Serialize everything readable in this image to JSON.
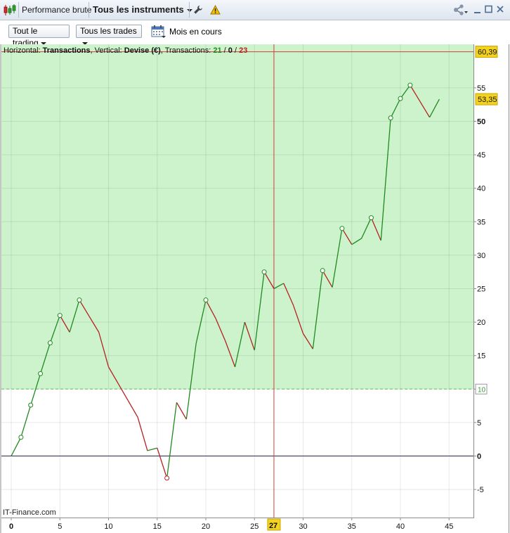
{
  "titlebar": {
    "tab1_label": "Performance brute",
    "tab2_label": "Tous les instruments",
    "icons": [
      "candlestick-icon",
      "wrench-icon",
      "warning-icon",
      "share-icon",
      "minimize-icon",
      "maximize-icon",
      "close-icon"
    ]
  },
  "toolbar": {
    "trading_select": "Tout le trading",
    "trades_select": "Tous les trades",
    "period_label": "Mois en cours"
  },
  "chart_info": {
    "h_prefix": "Horizontal: ",
    "h_value": "Transactions",
    "v_prefix": ", Vertical: ",
    "v_value": "Devise (€)",
    "t_prefix": ", Transactions: ",
    "wins": "21",
    "sep1": " / ",
    "neutral": "0",
    "sep2": " / ",
    "total": "23"
  },
  "watermark": "IT-Finance.com",
  "badges": {
    "max_value": "60,39",
    "last_value": "53,35",
    "threshold": "10",
    "cursor_x": "27"
  },
  "colors": {
    "up": "#1f8a1f",
    "down": "#b42020",
    "zone": "#cdf3cd",
    "crosshair": "#d23c3c",
    "badge": "#f4d31e"
  },
  "chart_data": {
    "type": "line",
    "x": [
      0,
      1,
      2,
      3,
      4,
      5,
      6,
      7,
      8,
      9,
      10,
      11,
      12,
      13,
      14,
      15,
      16,
      17,
      18,
      19,
      20,
      21,
      22,
      23,
      24,
      25,
      26,
      27,
      28,
      29,
      30,
      31,
      32,
      33,
      34,
      35,
      36,
      37,
      38,
      39,
      40,
      41,
      42,
      43,
      44
    ],
    "y": [
      0,
      2.8,
      7.6,
      12.3,
      16.9,
      21,
      18.5,
      23.3,
      20.9,
      18.5,
      13.3,
      10.8,
      8.3,
      5.8,
      0.8,
      1.2,
      -3.3,
      8,
      5.5,
      16.8,
      23.3,
      20.6,
      17.2,
      13.3,
      20,
      15.8,
      27.5,
      25,
      25.8,
      22.5,
      18.3,
      16,
      27.7,
      25.2,
      34,
      31.6,
      32.5,
      35.6,
      32.2,
      50.5,
      53.4,
      55.4,
      53,
      50.6,
      53.3
    ],
    "markers_x": [
      1,
      2,
      3,
      4,
      5,
      7,
      16,
      20,
      26,
      32,
      34,
      37,
      39,
      40,
      41
    ],
    "ylim": [
      -8,
      61
    ],
    "xlim": [
      -1,
      47.3
    ],
    "xticks": [
      "0",
      "5",
      "10",
      "15",
      "20",
      "25",
      "30",
      "35",
      "40",
      "45"
    ],
    "yticks": [
      "-5",
      "0",
      "5",
      "10",
      "15",
      "20",
      "25",
      "30",
      "35",
      "40",
      "45",
      "50",
      "55"
    ],
    "threshold_y": 10,
    "max_y": 60.39,
    "cursor_x": 27,
    "grid": true,
    "xlabel": "Transactions",
    "ylabel": "Devise (€)"
  }
}
